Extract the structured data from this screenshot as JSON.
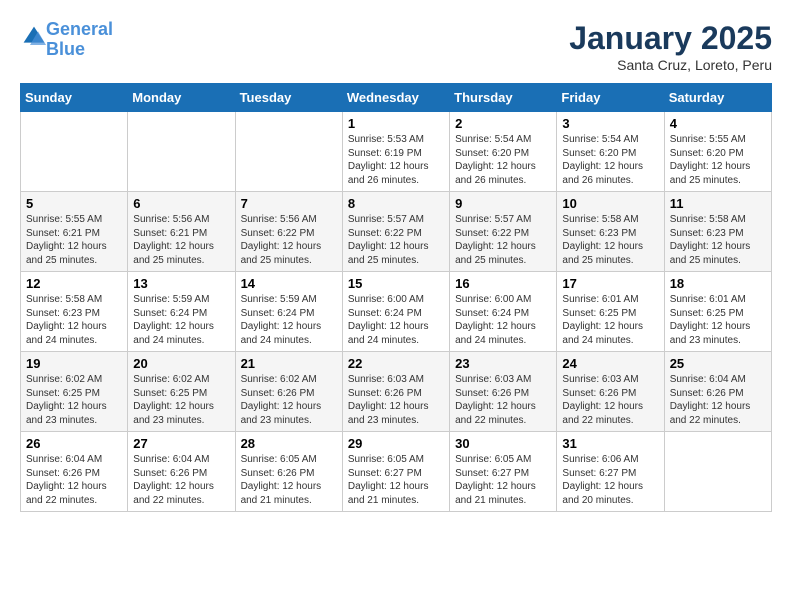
{
  "logo": {
    "line1": "General",
    "line2": "Blue"
  },
  "title": "January 2025",
  "subtitle": "Santa Cruz, Loreto, Peru",
  "weekdays": [
    "Sunday",
    "Monday",
    "Tuesday",
    "Wednesday",
    "Thursday",
    "Friday",
    "Saturday"
  ],
  "weeks": [
    [
      {
        "day": "",
        "info": ""
      },
      {
        "day": "",
        "info": ""
      },
      {
        "day": "",
        "info": ""
      },
      {
        "day": "1",
        "info": "Sunrise: 5:53 AM\nSunset: 6:19 PM\nDaylight: 12 hours\nand 26 minutes."
      },
      {
        "day": "2",
        "info": "Sunrise: 5:54 AM\nSunset: 6:20 PM\nDaylight: 12 hours\nand 26 minutes."
      },
      {
        "day": "3",
        "info": "Sunrise: 5:54 AM\nSunset: 6:20 PM\nDaylight: 12 hours\nand 26 minutes."
      },
      {
        "day": "4",
        "info": "Sunrise: 5:55 AM\nSunset: 6:20 PM\nDaylight: 12 hours\nand 25 minutes."
      }
    ],
    [
      {
        "day": "5",
        "info": "Sunrise: 5:55 AM\nSunset: 6:21 PM\nDaylight: 12 hours\nand 25 minutes."
      },
      {
        "day": "6",
        "info": "Sunrise: 5:56 AM\nSunset: 6:21 PM\nDaylight: 12 hours\nand 25 minutes."
      },
      {
        "day": "7",
        "info": "Sunrise: 5:56 AM\nSunset: 6:22 PM\nDaylight: 12 hours\nand 25 minutes."
      },
      {
        "day": "8",
        "info": "Sunrise: 5:57 AM\nSunset: 6:22 PM\nDaylight: 12 hours\nand 25 minutes."
      },
      {
        "day": "9",
        "info": "Sunrise: 5:57 AM\nSunset: 6:22 PM\nDaylight: 12 hours\nand 25 minutes."
      },
      {
        "day": "10",
        "info": "Sunrise: 5:58 AM\nSunset: 6:23 PM\nDaylight: 12 hours\nand 25 minutes."
      },
      {
        "day": "11",
        "info": "Sunrise: 5:58 AM\nSunset: 6:23 PM\nDaylight: 12 hours\nand 25 minutes."
      }
    ],
    [
      {
        "day": "12",
        "info": "Sunrise: 5:58 AM\nSunset: 6:23 PM\nDaylight: 12 hours\nand 24 minutes."
      },
      {
        "day": "13",
        "info": "Sunrise: 5:59 AM\nSunset: 6:24 PM\nDaylight: 12 hours\nand 24 minutes."
      },
      {
        "day": "14",
        "info": "Sunrise: 5:59 AM\nSunset: 6:24 PM\nDaylight: 12 hours\nand 24 minutes."
      },
      {
        "day": "15",
        "info": "Sunrise: 6:00 AM\nSunset: 6:24 PM\nDaylight: 12 hours\nand 24 minutes."
      },
      {
        "day": "16",
        "info": "Sunrise: 6:00 AM\nSunset: 6:24 PM\nDaylight: 12 hours\nand 24 minutes."
      },
      {
        "day": "17",
        "info": "Sunrise: 6:01 AM\nSunset: 6:25 PM\nDaylight: 12 hours\nand 24 minutes."
      },
      {
        "day": "18",
        "info": "Sunrise: 6:01 AM\nSunset: 6:25 PM\nDaylight: 12 hours\nand 23 minutes."
      }
    ],
    [
      {
        "day": "19",
        "info": "Sunrise: 6:02 AM\nSunset: 6:25 PM\nDaylight: 12 hours\nand 23 minutes."
      },
      {
        "day": "20",
        "info": "Sunrise: 6:02 AM\nSunset: 6:25 PM\nDaylight: 12 hours\nand 23 minutes."
      },
      {
        "day": "21",
        "info": "Sunrise: 6:02 AM\nSunset: 6:26 PM\nDaylight: 12 hours\nand 23 minutes."
      },
      {
        "day": "22",
        "info": "Sunrise: 6:03 AM\nSunset: 6:26 PM\nDaylight: 12 hours\nand 23 minutes."
      },
      {
        "day": "23",
        "info": "Sunrise: 6:03 AM\nSunset: 6:26 PM\nDaylight: 12 hours\nand 22 minutes."
      },
      {
        "day": "24",
        "info": "Sunrise: 6:03 AM\nSunset: 6:26 PM\nDaylight: 12 hours\nand 22 minutes."
      },
      {
        "day": "25",
        "info": "Sunrise: 6:04 AM\nSunset: 6:26 PM\nDaylight: 12 hours\nand 22 minutes."
      }
    ],
    [
      {
        "day": "26",
        "info": "Sunrise: 6:04 AM\nSunset: 6:26 PM\nDaylight: 12 hours\nand 22 minutes."
      },
      {
        "day": "27",
        "info": "Sunrise: 6:04 AM\nSunset: 6:26 PM\nDaylight: 12 hours\nand 22 minutes."
      },
      {
        "day": "28",
        "info": "Sunrise: 6:05 AM\nSunset: 6:26 PM\nDaylight: 12 hours\nand 21 minutes."
      },
      {
        "day": "29",
        "info": "Sunrise: 6:05 AM\nSunset: 6:27 PM\nDaylight: 12 hours\nand 21 minutes."
      },
      {
        "day": "30",
        "info": "Sunrise: 6:05 AM\nSunset: 6:27 PM\nDaylight: 12 hours\nand 21 minutes."
      },
      {
        "day": "31",
        "info": "Sunrise: 6:06 AM\nSunset: 6:27 PM\nDaylight: 12 hours\nand 20 minutes."
      },
      {
        "day": "",
        "info": ""
      }
    ]
  ]
}
